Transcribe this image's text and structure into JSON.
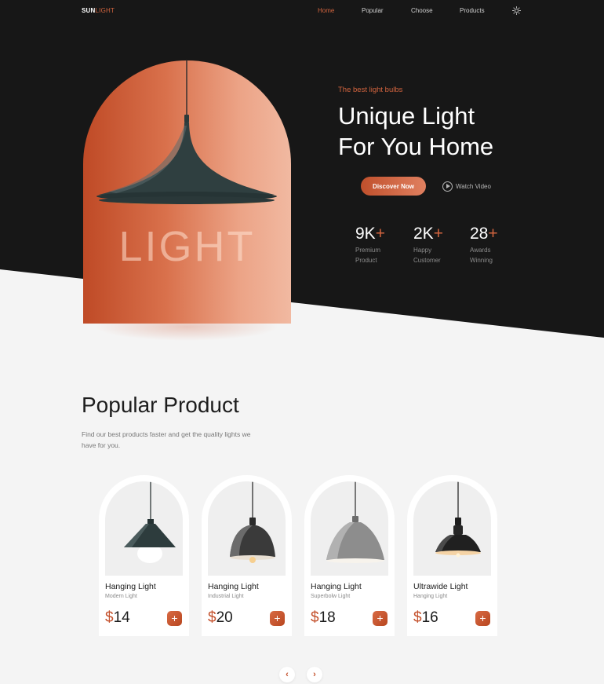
{
  "colors": {
    "accent": "#d4653f",
    "dark": "#171717",
    "light": "#f4f4f4"
  },
  "logo": {
    "part1": "SUN",
    "part2": "LIGHT"
  },
  "nav": {
    "links": [
      "Home",
      "Popular",
      "Choose",
      "Products"
    ],
    "active": "Home",
    "theme_icon": "sun-icon"
  },
  "hero": {
    "tagline": "The best light bulbs",
    "headline_line1": "Unique Light",
    "headline_line2": "For You Home",
    "arch_word": "LIGHT",
    "discover_label": "Discover Now",
    "watch_label": "Watch Video",
    "stats": [
      {
        "value": "9K",
        "plus": "+",
        "label": "Premium Product"
      },
      {
        "value": "2K",
        "plus": "+",
        "label": "Happy Customer"
      },
      {
        "value": "28",
        "plus": "+",
        "label": "Awards Winning"
      }
    ]
  },
  "popular": {
    "title": "Popular Product",
    "description": "Find our best products faster and get the quality lights we have for you.",
    "products": [
      {
        "name": "Hanging Light",
        "type": "Modern Light",
        "currency": "$",
        "price": "14",
        "add": "+"
      },
      {
        "name": "Hanging Light",
        "type": "Industrial Light",
        "currency": "$",
        "price": "20",
        "add": "+"
      },
      {
        "name": "Hanging Light",
        "type": "Superbolw Light",
        "currency": "$",
        "price": "18",
        "add": "+"
      },
      {
        "name": "Ultrawide Light",
        "type": "Hanging Light",
        "currency": "$",
        "price": "16",
        "add": "+"
      }
    ]
  },
  "pager": {
    "prev": "‹",
    "next": "›"
  }
}
